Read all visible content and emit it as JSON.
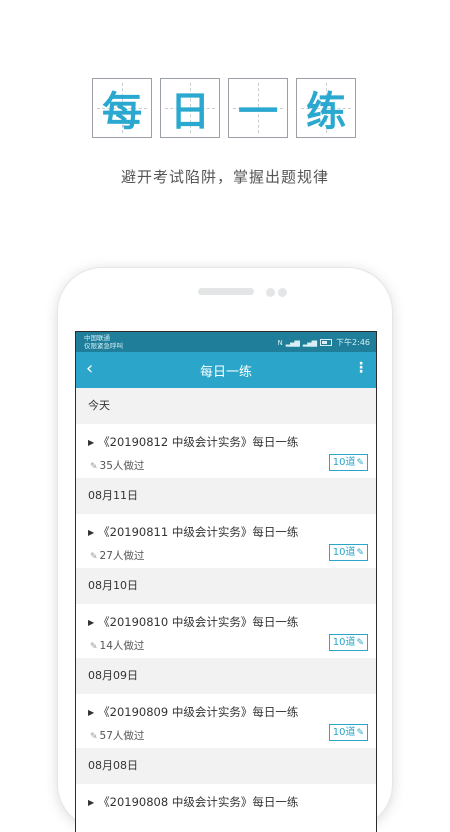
{
  "hero": {
    "chars": [
      "每",
      "日",
      "一",
      "练"
    ],
    "subtitle": "避开考试陷阱，掌握出题规律"
  },
  "status_bar": {
    "carrier_line1": "中国联通",
    "carrier_line2": "仅限紧急呼叫",
    "time": "下午2:46"
  },
  "app_bar": {
    "title": "每日一练",
    "back_icon": "‹",
    "more_icon": "⋮"
  },
  "groups": [
    {
      "date": "今天",
      "title": "《20190812 中级会计实务》每日一练",
      "count": "35人做过",
      "badge": "10道"
    },
    {
      "date": "08月11日",
      "title": "《20190811 中级会计实务》每日一练",
      "count": "27人做过",
      "badge": "10道"
    },
    {
      "date": "08月10日",
      "title": "《20190810 中级会计实务》每日一练",
      "count": "14人做过",
      "badge": "10道"
    },
    {
      "date": "08月09日",
      "title": "《20190809 中级会计实务》每日一练",
      "count": "57人做过",
      "badge": "10道"
    },
    {
      "date": "08月08日",
      "title": "《20190808 中级会计实务》每日一练",
      "count": "",
      "badge": ""
    }
  ],
  "colors": {
    "accent": "#2ba6ca",
    "status_bar": "#1f7f9a",
    "hero_char": "#2aa8cf"
  }
}
